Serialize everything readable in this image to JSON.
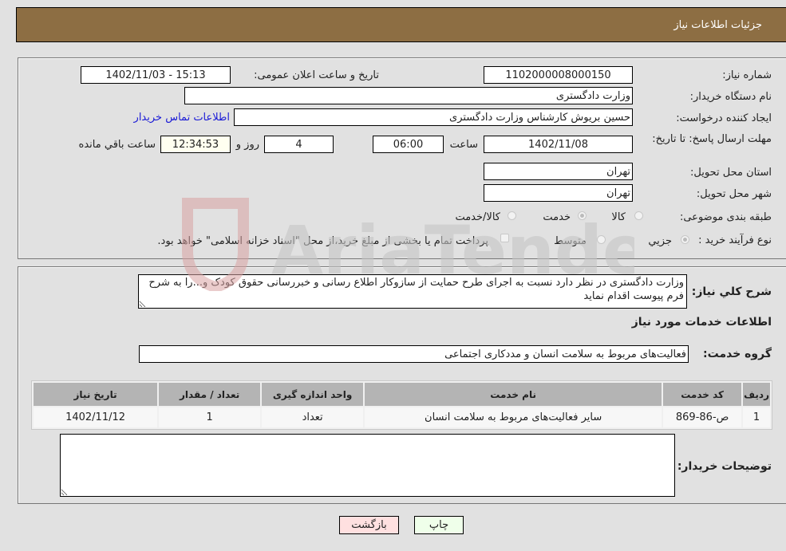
{
  "header": {
    "title": "جزئیات اطلاعات نیاز"
  },
  "form": {
    "need_number_label": "شماره نیاز:",
    "need_number": "1102000008000150",
    "announce_label": "تاریخ و ساعت اعلان عمومی:",
    "announce_value": "1402/11/03 - 15:13",
    "buyer_org_label": "نام دستگاه خریدار:",
    "buyer_org": "وزارت دادگستری",
    "creator_label": "ایجاد کننده درخواست:",
    "creator": "حسین بریوش کارشناس وزارت دادگستری",
    "contact_link": "اطلاعات تماس خریدار",
    "deadline_label": "مهلت ارسال پاسخ: تا تاریخ:",
    "deadline_date": "1402/11/08",
    "time_label": "ساعت",
    "deadline_time": "06:00",
    "days": "4",
    "days_label": "روز و",
    "remaining": "12:34:53",
    "remaining_label": "ساعت باقي مانده",
    "province_label": "استان محل تحویل:",
    "province": "تهران",
    "city_label": "شهر محل تحویل:",
    "city": "تهران",
    "category_label": "طبقه بندی موضوعی:",
    "category_options": [
      {
        "label": "کالا",
        "checked": false
      },
      {
        "label": "خدمت",
        "checked": true
      },
      {
        "label": "کالا/خدمت",
        "checked": false
      }
    ],
    "process_label": "نوع فرآیند خرید :",
    "process_options": [
      {
        "label": "جزيي",
        "checked": true
      },
      {
        "label": "متوسط",
        "checked": false
      }
    ],
    "treasury_note": "پرداخت تمام یا بخشی از مبلغ خرید،از محل \"اسناد خزانه اسلامی\" خواهد بود."
  },
  "details": {
    "description_label": "شرح كلي نياز:",
    "description": "وزارت دادگستری در نظر دارد نسبت به اجرای طرح حمایت از سازوکار اطلاع رسانی و خبررسانی حقوق کودک و...را به شرح فرم پیوست اقدام نماید",
    "services_heading": "اطلاعات خدمات مورد نیاز",
    "service_group_label": "گروه خدمت:",
    "service_group": "فعالیت‌های مربوط به سلامت انسان و مددکاری اجتماعی",
    "table": {
      "headers": [
        "ردیف",
        "کد خدمت",
        "نام خدمت",
        "واحد اندازه گیری",
        "تعداد / مقدار",
        "تاریخ نیاز"
      ],
      "rows": [
        [
          "1",
          "ص-86-869",
          "سایر فعالیت‌های مربوط به سلامت انسان",
          "تعداد",
          "1",
          "1402/11/12"
        ]
      ]
    },
    "buyer_notes_label": "توضیحات خریدار:",
    "buyer_notes": ""
  },
  "buttons": {
    "print": "چاپ",
    "back": "بازگشت"
  },
  "colors": {
    "header_bg": "#8d6e43",
    "print_bg": "#efffea",
    "back_bg": "#ffe0e0",
    "link": "#1a1ad6"
  },
  "watermark": {
    "text": "AriaTender.neT"
  }
}
